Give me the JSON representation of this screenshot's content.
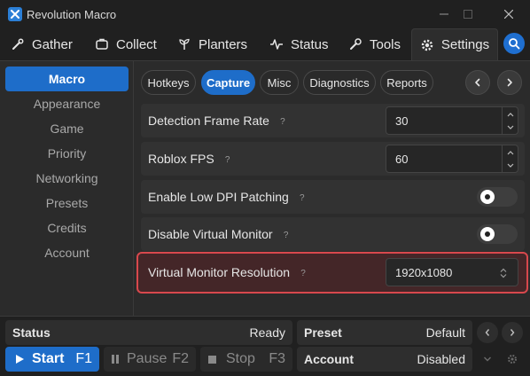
{
  "app": {
    "title": "Revolution Macro"
  },
  "main_tabs": [
    {
      "label": "Gather",
      "icon": "gather-icon"
    },
    {
      "label": "Collect",
      "icon": "collect-icon"
    },
    {
      "label": "Planters",
      "icon": "planters-icon"
    },
    {
      "label": "Status",
      "icon": "status-pulse-icon"
    },
    {
      "label": "Tools",
      "icon": "wrench-icon"
    },
    {
      "label": "Settings",
      "icon": "gear-icon",
      "active": true
    }
  ],
  "sidebar": {
    "items": [
      {
        "label": "Macro",
        "active": true
      },
      {
        "label": "Appearance"
      },
      {
        "label": "Game"
      },
      {
        "label": "Priority"
      },
      {
        "label": "Networking"
      },
      {
        "label": "Presets"
      },
      {
        "label": "Credits"
      },
      {
        "label": "Account"
      }
    ]
  },
  "sub_tabs": [
    {
      "label": "Hotkeys"
    },
    {
      "label": "Capture",
      "active": true
    },
    {
      "label": "Misc"
    },
    {
      "label": "Diagnostics"
    },
    {
      "label": "Reports"
    }
  ],
  "settings": {
    "detection_frame_rate": {
      "label": "Detection Frame Rate",
      "help": "?",
      "value": "30"
    },
    "roblox_fps": {
      "label": "Roblox FPS",
      "help": "?",
      "value": "60"
    },
    "low_dpi_patching": {
      "label": "Enable Low DPI Patching",
      "help": "?",
      "enabled": false
    },
    "disable_virtual_monitor": {
      "label": "Disable Virtual Monitor",
      "help": "?",
      "enabled": false
    },
    "virtual_monitor_resolution": {
      "label": "Virtual Monitor Resolution",
      "help": "?",
      "value": "1920x1080"
    }
  },
  "bottom": {
    "status": {
      "label": "Status",
      "value": "Ready"
    },
    "preset": {
      "label": "Preset",
      "value": "Default"
    },
    "account": {
      "label": "Account",
      "value": "Disabled"
    },
    "start": {
      "label": "Start",
      "hotkey": "F1"
    },
    "pause": {
      "label": "Pause",
      "hotkey": "F2"
    },
    "stop": {
      "label": "Stop",
      "hotkey": "F3"
    }
  },
  "colors": {
    "accent": "#1e6dc9",
    "highlight_border": "#d8484d",
    "background": "#202020",
    "panel": "#2b2b2b"
  }
}
